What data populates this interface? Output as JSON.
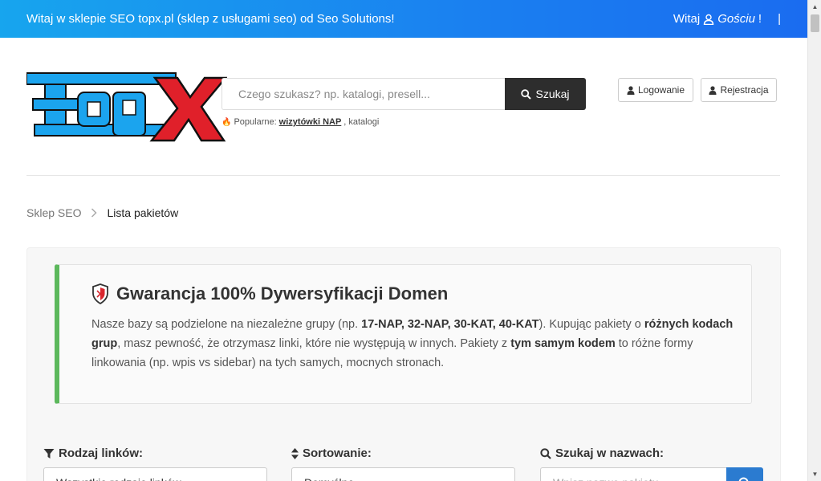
{
  "topbar": {
    "welcome": "Witaj w sklepie SEO topx.pl (sklep z usługami seo) od Seo Solutions!",
    "greeting": "Witaj",
    "guest": "Gościu",
    "exclaim": "!",
    "separator": "|"
  },
  "logo": {
    "text": "topX",
    "colors": {
      "blue": "#1ba4ee",
      "red": "#e0202a",
      "dark": "#111111"
    }
  },
  "search": {
    "placeholder": "Czego szukasz? np. katalogi, presell...",
    "button": "Szukaj",
    "popular_label": "Popularne:",
    "popular_link": "wizytówki NAP",
    "popular_sep": ",",
    "popular_other": "katalogi"
  },
  "auth": {
    "login": "Logowanie",
    "register": "Rejestracja"
  },
  "breadcrumb": {
    "home": "Sklep SEO",
    "current": "Lista pakietów"
  },
  "notice": {
    "title": "Gwarancja 100% Dywersyfikacji Domen",
    "t1": "Nasze bazy są podzielone na niezależne grupy (np. ",
    "b1": "17-NAP, 32-NAP, 30-KAT, 40-KAT",
    "t2": "). Kupując pakiety o ",
    "b2": "różnych kodach grup",
    "t3": ", masz pewność, że otrzymasz linki, które nie występują w innych. Pakiety z ",
    "b3": "tym samym kodem",
    "t4": " to różne formy linkowania (np. wpis vs sidebar) na tych samych, mocnych stronach.",
    "accent": "#5cb85c"
  },
  "filters": {
    "type_label": "Rodzaj linków:",
    "type_value": "Wszystkie rodzaje linków",
    "sort_label": "Sortowanie:",
    "sort_value": "Domyślne",
    "name_label": "Szukaj w nazwach:",
    "name_placeholder": "Wpisz nazwę pakietu..."
  }
}
